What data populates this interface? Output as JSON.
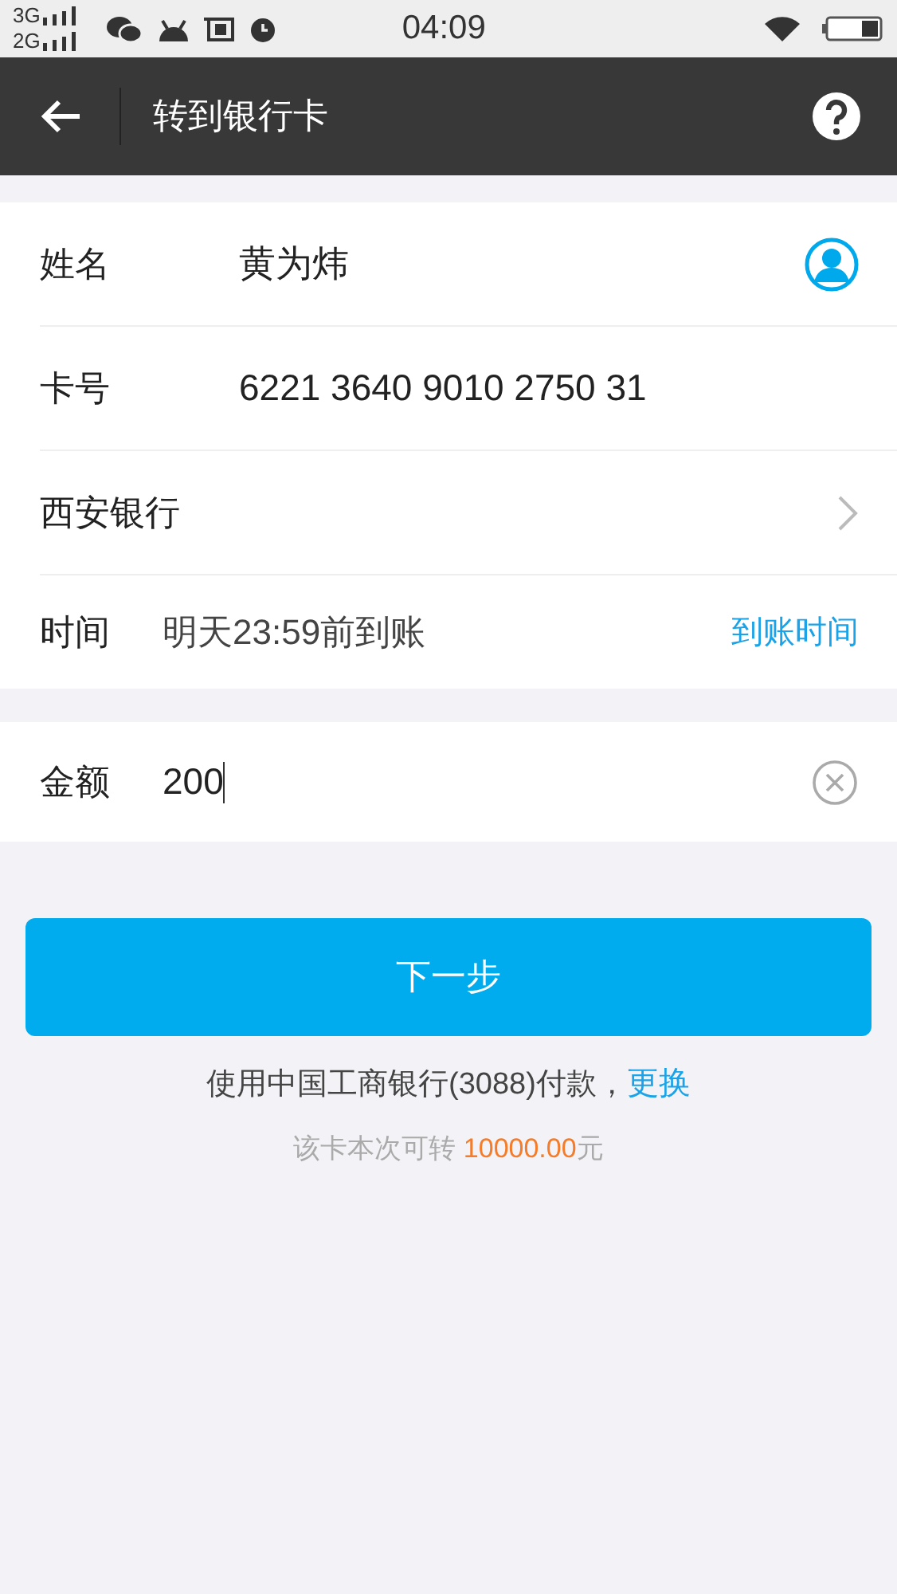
{
  "status_bar": {
    "networks": [
      "3G",
      "2G"
    ],
    "time": "04:09"
  },
  "header": {
    "title": "转到银行卡"
  },
  "rows": [
    {
      "kind": "name",
      "label": "姓名",
      "value": "黄为炜"
    },
    {
      "kind": "card",
      "label": "卡号",
      "value": "6221 3640 9010 2750 31"
    },
    {
      "kind": "bank",
      "label": "西安银行"
    },
    {
      "kind": "time",
      "label": "时间",
      "value": "明天23:59前到账",
      "link": "到账时间"
    }
  ],
  "amount": {
    "label": "金额",
    "value": "200"
  },
  "next_button": "下一步",
  "pay_note": {
    "text": "使用中国工商银行(3088)付款，",
    "link": "更换"
  },
  "limit": {
    "prefix": "该卡本次可转 ",
    "amount": "10000.00",
    "suffix": "元"
  }
}
